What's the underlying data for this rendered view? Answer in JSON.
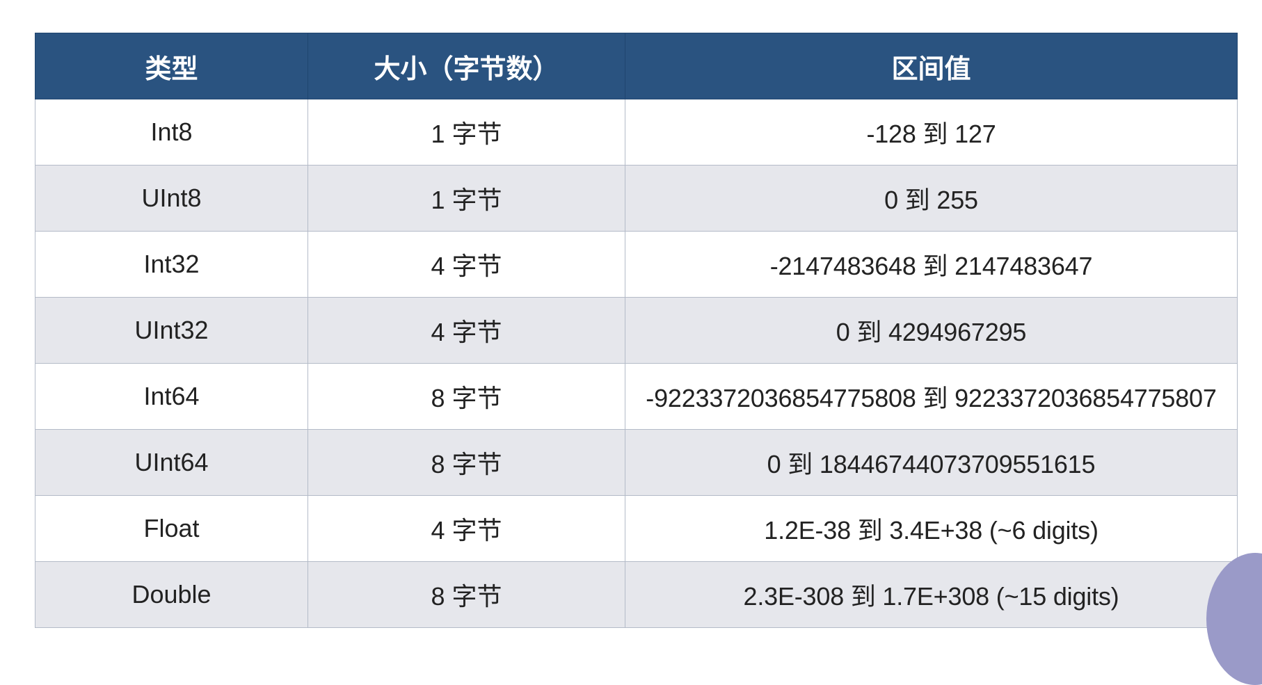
{
  "table": {
    "headers": [
      "类型",
      "大小（字节数）",
      "区间值"
    ],
    "rows": [
      [
        "Int8",
        "1 字节",
        "-128 到 127"
      ],
      [
        "UInt8",
        "1 字节",
        "0 到 255"
      ],
      [
        "Int32",
        "4 字节",
        "-2147483648 到 2147483647"
      ],
      [
        "UInt32",
        "4 字节",
        "0 到 4294967295"
      ],
      [
        "Int64",
        "8 字节",
        "-9223372036854775808 到 9223372036854775807"
      ],
      [
        "UInt64",
        "8 字节",
        "0 到 18446744073709551615"
      ],
      [
        "Float",
        "4 字节",
        "1.2E-38 到 3.4E+38 (~6 digits)"
      ],
      [
        "Double",
        "8 字节",
        "2.3E-308 到 1.7E+308 (~15 digits)"
      ]
    ]
  },
  "colors": {
    "header_bg": "#2a5380",
    "header_text": "#ffffff",
    "row_alt_bg": "#e6e7ec",
    "row_bg": "#ffffff",
    "border": "#b4bbc8",
    "corner_circle": "#9a9ac8"
  }
}
